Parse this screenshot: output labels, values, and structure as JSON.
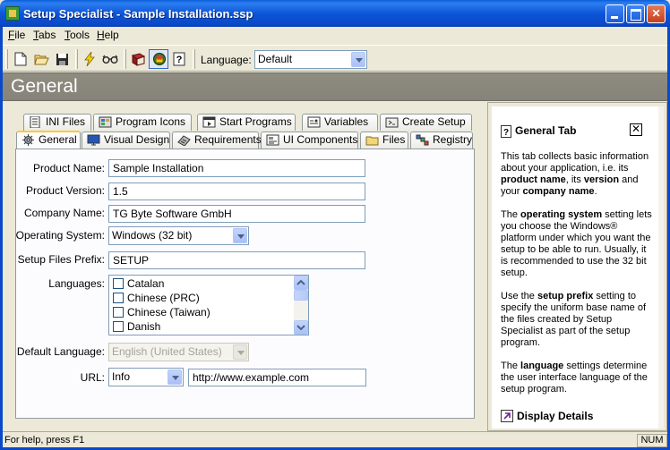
{
  "window": {
    "title": "Setup Specialist - Sample Installation.ssp"
  },
  "menu": [
    {
      "label": "File",
      "u": "F",
      "rest": "ile"
    },
    {
      "label": "Tabs",
      "u": "T",
      "rest": "abs"
    },
    {
      "label": "Tools",
      "u": "T",
      "rest": "ools"
    },
    {
      "label": "Help",
      "u": "H",
      "rest": "elp"
    }
  ],
  "toolbar": {
    "language_label": "Language:",
    "language_value": "Default",
    "icons": [
      "new-file-icon",
      "open-folder-icon",
      "save-icon",
      "build-lightning-icon",
      "test-glasses-icon",
      "book-icon",
      "wizard-icon",
      "context-help-icon"
    ]
  },
  "header": {
    "title": "General"
  },
  "tabs": {
    "row1": [
      "INI Files",
      "Program Icons",
      "Start Programs",
      "Variables",
      "Create Setup"
    ],
    "row2": [
      "General",
      "Visual Design",
      "Requirements",
      "UI Components",
      "Files",
      "Registry"
    ],
    "active": "General"
  },
  "form": {
    "product_name": {
      "label": "Product Name:",
      "value": "Sample Installation"
    },
    "product_version": {
      "label": "Product Version:",
      "value": "1.5"
    },
    "company_name": {
      "label": "Company Name:",
      "value": "TG Byte Software GmbH"
    },
    "operating_system": {
      "label": "Operating System:",
      "value": "Windows (32 bit)"
    },
    "setup_files_prefix": {
      "label": "Setup Files Prefix:",
      "value": "SETUP"
    },
    "languages": {
      "label": "Languages:",
      "items": [
        "Catalan",
        "Chinese (PRC)",
        "Chinese (Taiwan)",
        "Danish"
      ]
    },
    "default_language": {
      "label": "Default Language:",
      "value": "English (United States)"
    },
    "url": {
      "label": "URL:",
      "type": "Info",
      "value": "http://www.example.com"
    }
  },
  "help": {
    "title": "General Tab",
    "p1_a": "This tab collects basic information about your application, i.e. its ",
    "p1_b": "product name",
    "p1_c": ", its ",
    "p1_d": "version",
    "p1_e": " and your ",
    "p1_f": "company name",
    "p1_g": ".",
    "p2_a": "The ",
    "p2_b": "operating system",
    "p2_c": " setting lets you choose the Windows® platform under which you want the setup to be able to run. Usually, it is recommended to use the 32 bit setup.",
    "p3_a": "Use the ",
    "p3_b": "setup prefix",
    "p3_c": " setting to specify the uniform base name of the files created by Setup Specialist as part of the setup program.",
    "p4_a": "The ",
    "p4_b": "language",
    "p4_c": " settings determine the user interface language of the setup program.",
    "display_details": "Display Details"
  },
  "status": {
    "text": "For help, press F1",
    "num": "NUM"
  }
}
